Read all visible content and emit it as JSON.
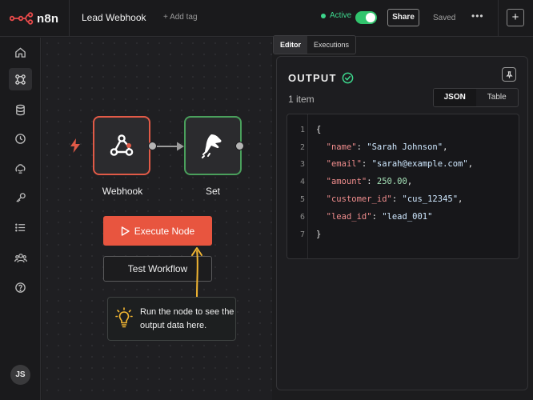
{
  "app": {
    "logo_text": "n8n",
    "workflow_name": "Lead Webhook",
    "add_tag": "+ Add tag",
    "status": "Active",
    "toggle_on": true,
    "share_label": "Share",
    "saved_label": "Saved",
    "more_label": "•••",
    "new_label": "+"
  },
  "sidebar": {
    "items": [
      {
        "icon": "home-icon"
      },
      {
        "icon": "workflows-icon",
        "active": true
      },
      {
        "icon": "database-icon"
      },
      {
        "icon": "history-icon"
      },
      {
        "icon": "templates-icon"
      },
      {
        "icon": "credentials-icon"
      },
      {
        "icon": "list-icon"
      },
      {
        "icon": "users-icon"
      },
      {
        "icon": "help-icon"
      }
    ],
    "avatar_initials": "JS"
  },
  "canvas": {
    "nodes": [
      {
        "label": "Webhook",
        "icon": "webhook-icon",
        "color": "#e15a47"
      },
      {
        "label": "Set",
        "icon": "set-icon",
        "color": "#4aa05c"
      }
    ],
    "execute_label": "Execute Node",
    "test_label": "Test Workflow",
    "hint": "Run the node to see the output data here."
  },
  "panel": {
    "tabs": [
      {
        "label": "Editor",
        "active": true
      },
      {
        "label": "Executions",
        "active": false
      }
    ],
    "title": "OUTPUT",
    "items_count": "1 item",
    "views": [
      {
        "label": "JSON",
        "active": true
      },
      {
        "label": "Table",
        "active": false
      }
    ],
    "code": {
      "open": "{",
      "close": "}",
      "fields": [
        {
          "key": "\"name\"",
          "value": "\"Sarah Johnson\"",
          "type": "string"
        },
        {
          "key": "\"email\"",
          "value": "\"sarah@example.com\"",
          "type": "string"
        },
        {
          "key": "\"amount\"",
          "value": "250.00",
          "type": "number"
        },
        {
          "key": "\"customer_id\"",
          "value": "\"cus_12345\"",
          "type": "string"
        },
        {
          "key": "\"lead_id\"",
          "value": "\"lead_001\"",
          "type": "string"
        }
      ],
      "line_numbers": [
        "1",
        "2",
        "3",
        "4",
        "5",
        "6",
        "7"
      ]
    }
  },
  "colors": {
    "accent": "#e8553f",
    "active_green": "#3dd68c",
    "hint_bulb": "#f2b632"
  }
}
